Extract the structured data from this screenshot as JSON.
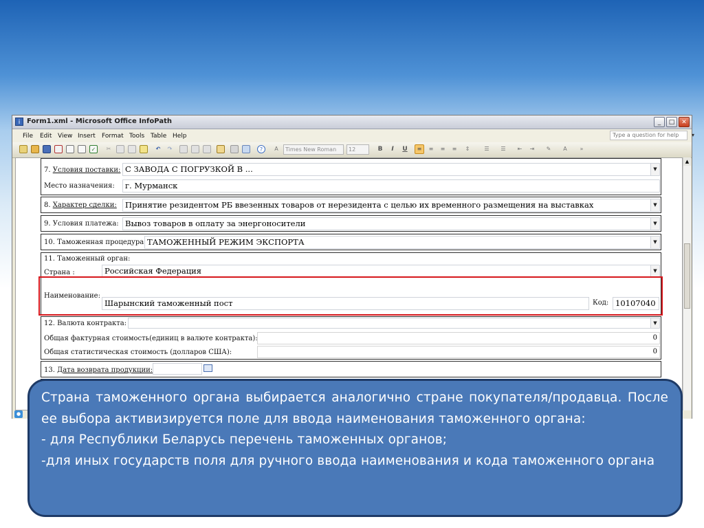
{
  "window": {
    "title": "Form1.xml - Microsoft Office InfoPath",
    "controls": {
      "minimize": "_",
      "maximize": "□",
      "close": "✕"
    }
  },
  "menu": [
    "File",
    "Edit",
    "View",
    "Insert",
    "Format",
    "Tools",
    "Table",
    "Help"
  ],
  "help_search": {
    "placeholder": "Type a question for help"
  },
  "toolbar": {
    "font_name": "Times New Roman",
    "font_size": "12",
    "bold": "B",
    "italic": "I",
    "underline": "U"
  },
  "form": {
    "delivery": {
      "label_num": "7. ",
      "label": "Условия поставки:",
      "value": "С ЗАВОДА С ПОГРУЗКОЙ В ...",
      "destination_label": "Место назначения:",
      "destination_value": "г. Мурманск"
    },
    "deal": {
      "label_num": "8. ",
      "label": "Характер сделки:",
      "value": "Принятие резидентом РБ ввезенных товаров от нерезидента с целью их временного размещения на выставках"
    },
    "payment": {
      "label": "9. Условия платежа:",
      "value": "Вывоз товаров в оплату за энергоносители"
    },
    "procedure": {
      "label": "10. Таможенная процедура:",
      "value": "ТАМОЖЕННЫЙ РЕЖИМ ЭКСПОРТА"
    },
    "customs": {
      "label": "11. Таможенный орган:",
      "country_label": "Страна :",
      "country_value": "Российская Федерация",
      "name_label": "Наименование:",
      "name_value": "Шарынский таможенный пост",
      "code_label": "Код:",
      "code_value": "10107040"
    },
    "currency": {
      "label": "12. Валюта контракта:",
      "value": "",
      "invoice_label": "Общая фактурная стоимость(единиц в валюте контракта):",
      "invoice_value": "0",
      "stat_label": "Общая статистическая стоимость (долларов США):",
      "stat_value": "0"
    },
    "return": {
      "label_num": "13. ",
      "label": "Дата возврата продукции:",
      "value": ""
    }
  },
  "callout": {
    "lines": [
      "Страна таможенного органа выбирается аналогично стране покупателя/продавца. После ее выбора активизируется поле для ввода наименования таможенного органа:",
      "- для Республики Беларусь перечень таможенных органов;",
      "-для иных государств поля для ручного ввода наименования и кода таможенного органа"
    ]
  },
  "colors": {
    "highlight_frame": "#d6161b",
    "callout_bg": "#4a79b8",
    "callout_border": "#1e3a66"
  }
}
